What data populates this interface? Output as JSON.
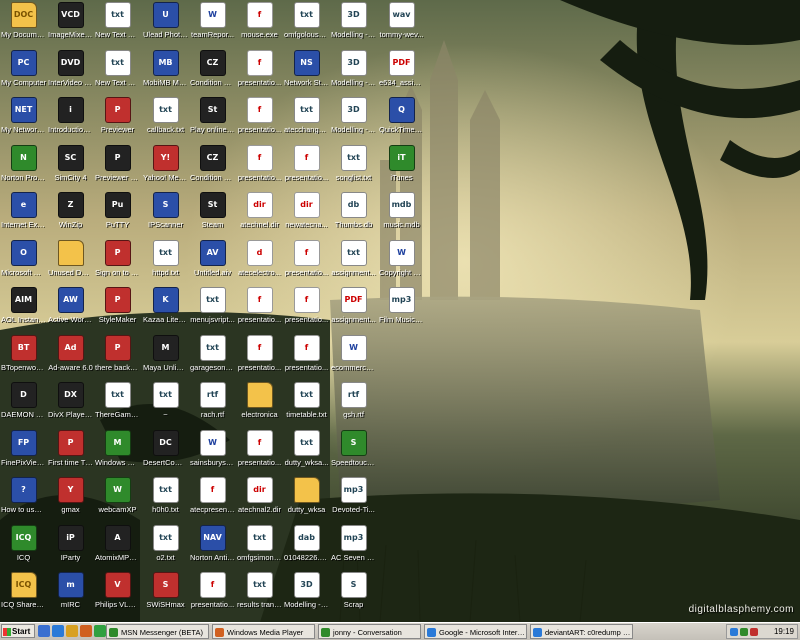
{
  "desktop": {
    "watermark": "digitalblasphemy.com",
    "icons": [
      {
        "label": "My Documents",
        "type": "folder",
        "glyph": "DOC"
      },
      {
        "label": "My Computer",
        "type": "app",
        "glyph": "PC"
      },
      {
        "label": "My Network Places",
        "type": "app",
        "glyph": "NET"
      },
      {
        "label": "Norton Protecte...",
        "type": "green",
        "glyph": "N"
      },
      {
        "label": "Internet Explorer",
        "type": "app",
        "glyph": "e"
      },
      {
        "label": "Microsoft Outlook",
        "type": "app",
        "glyph": "O"
      },
      {
        "label": "AOL Instant Messenger",
        "type": "dark",
        "glyph": "AIM"
      },
      {
        "label": "BTopenworld Broadband",
        "type": "red",
        "glyph": "BT"
      },
      {
        "label": "DAEMON Tools",
        "type": "dark",
        "glyph": "D"
      },
      {
        "label": "FinePixViewer",
        "type": "app",
        "glyph": "FP"
      },
      {
        "label": "How to use FinePixViewer",
        "type": "app",
        "glyph": "?"
      },
      {
        "label": "ICQ",
        "type": "green",
        "glyph": "ICQ"
      },
      {
        "label": "ICQ Shared Files",
        "type": "folder",
        "glyph": "ICQ"
      },
      {
        "label": "ImageMixer VCD for ...",
        "type": "dark",
        "glyph": "VCD"
      },
      {
        "label": "InterVideo WinDVD",
        "type": "dark",
        "glyph": "DVD"
      },
      {
        "label": "Introduction of Picture T...",
        "type": "dark",
        "glyph": "i"
      },
      {
        "label": "SimCity 4",
        "type": "dark",
        "glyph": "SC"
      },
      {
        "label": "WinZip",
        "type": "dark",
        "glyph": "Z"
      },
      {
        "label": "Unused Deskto...",
        "type": "folder",
        "glyph": ""
      },
      {
        "label": "Active Worlds",
        "type": "app",
        "glyph": "AW"
      },
      {
        "label": "Ad-aware 6.0",
        "type": "red",
        "glyph": "Ad"
      },
      {
        "label": "DivX Player 2.0 Alpha",
        "type": "dark",
        "glyph": "DX"
      },
      {
        "label": "First time There",
        "type": "red",
        "glyph": "P"
      },
      {
        "label": "gmax",
        "type": "red",
        "glyph": "Y"
      },
      {
        "label": "IParty",
        "type": "dark",
        "glyph": "iP"
      },
      {
        "label": "mIRC",
        "type": "app",
        "glyph": "m"
      },
      {
        "label": "New Text Docum...",
        "type": "doc",
        "glyph": "txt"
      },
      {
        "label": "New Text Document.txt",
        "type": "doc",
        "glyph": "txt"
      },
      {
        "label": "Previewer",
        "type": "red",
        "glyph": "P"
      },
      {
        "label": "Previewer Documenta...",
        "type": "dark",
        "glyph": "P"
      },
      {
        "label": "PuTTY",
        "type": "dark",
        "glyph": "Pu"
      },
      {
        "label": "Sign on to There",
        "type": "red",
        "glyph": "P"
      },
      {
        "label": "StyleMaker",
        "type": "red",
        "glyph": "P"
      },
      {
        "label": "there backdoor",
        "type": "red",
        "glyph": "P"
      },
      {
        "label": "ThereGame....",
        "type": "doc",
        "glyph": "txt"
      },
      {
        "label": "Windows Messenger",
        "type": "green",
        "glyph": "M"
      },
      {
        "label": "webcamXP",
        "type": "green",
        "glyph": "W"
      },
      {
        "label": "AtomixMP3 Trial",
        "type": "dark",
        "glyph": "A"
      },
      {
        "label": "Philips VLounge",
        "type": "red",
        "glyph": "V"
      },
      {
        "label": "Ulead Photo Explorer 6.0",
        "type": "app",
        "glyph": "U"
      },
      {
        "label": "MobiMB Mobile Media Browser",
        "type": "app",
        "glyph": "MB"
      },
      {
        "label": "callback.txt",
        "type": "doc",
        "glyph": "txt"
      },
      {
        "label": "Yahoo! Messenger",
        "type": "red",
        "glyph": "Y!"
      },
      {
        "label": "IPScanner",
        "type": "app",
        "glyph": "S"
      },
      {
        "label": "httpd.txt",
        "type": "doc",
        "glyph": "txt"
      },
      {
        "label": "Kazaa Lite K++",
        "type": "app",
        "glyph": "K"
      },
      {
        "label": "Maya Unlimited 5.0",
        "type": "dark",
        "glyph": "M"
      },
      {
        "label": "~",
        "type": "doc",
        "glyph": "txt"
      },
      {
        "label": "DesertCombat...",
        "type": "dark",
        "glyph": "DC"
      },
      {
        "label": "h0h0.txt",
        "type": "doc",
        "glyph": "txt"
      },
      {
        "label": "o2.txt",
        "type": "doc",
        "glyph": "txt"
      },
      {
        "label": "SWiSHmax",
        "type": "red",
        "glyph": "S"
      },
      {
        "label": "teamRepor...",
        "type": "word",
        "glyph": "W"
      },
      {
        "label": "Condition Zero",
        "type": "dark",
        "glyph": "CZ"
      },
      {
        "label": "Play online using Steam",
        "type": "dark",
        "glyph": "St"
      },
      {
        "label": "Condition Zero Deleted Sce...",
        "type": "dark",
        "glyph": "CZ"
      },
      {
        "label": "Steam",
        "type": "dark",
        "glyph": "St"
      },
      {
        "label": "Untitled.aiv",
        "type": "app",
        "glyph": "AV"
      },
      {
        "label": "menujsvript...",
        "type": "doc",
        "glyph": "txt"
      },
      {
        "label": "garagesong...",
        "type": "doc",
        "glyph": "txt"
      },
      {
        "label": "rach.rtf",
        "type": "doc",
        "glyph": "rtf"
      },
      {
        "label": "sainsburystr...",
        "type": "word",
        "glyph": "W"
      },
      {
        "label": "atecpresent...",
        "type": "flash",
        "glyph": "f"
      },
      {
        "label": "Norton AntiVirus 20...",
        "type": "app",
        "glyph": "NAV"
      },
      {
        "label": "presentatio...",
        "type": "flash",
        "glyph": "f"
      },
      {
        "label": "mouse.exe",
        "type": "flash",
        "glyph": "f"
      },
      {
        "label": "presentatio...",
        "type": "flash",
        "glyph": "f"
      },
      {
        "label": "presentatio...",
        "type": "flash",
        "glyph": "f"
      },
      {
        "label": "presentatio...",
        "type": "flash",
        "glyph": "f"
      },
      {
        "label": "atechnel.dir",
        "type": "flash",
        "glyph": "dir"
      },
      {
        "label": "atecelectro...",
        "type": "flash",
        "glyph": "d"
      },
      {
        "label": "presentatio...",
        "type": "flash",
        "glyph": "f"
      },
      {
        "label": "presentatio...",
        "type": "flash",
        "glyph": "f"
      },
      {
        "label": "electronica",
        "type": "folder",
        "glyph": ""
      },
      {
        "label": "presentatio...",
        "type": "flash",
        "glyph": "f"
      },
      {
        "label": "atechnal2.dir",
        "type": "flash",
        "glyph": "dir"
      },
      {
        "label": "omfgsimon.txt",
        "type": "doc",
        "glyph": "txt"
      },
      {
        "label": "results transcript si...",
        "type": "doc",
        "glyph": "txt"
      },
      {
        "label": "omfgolouse.txt",
        "type": "doc",
        "glyph": "txt"
      },
      {
        "label": "Network Stumbler",
        "type": "app",
        "glyph": "NS"
      },
      {
        "label": "atecchange...",
        "type": "doc",
        "glyph": "txt"
      },
      {
        "label": "presentatio...",
        "type": "flash",
        "glyph": "f"
      },
      {
        "label": "newatecna...",
        "type": "flash",
        "glyph": "dir"
      },
      {
        "label": "presentatio...",
        "type": "flash",
        "glyph": "f"
      },
      {
        "label": "presentatio...",
        "type": "flash",
        "glyph": "f"
      },
      {
        "label": "presentatio...",
        "type": "flash",
        "glyph": "f"
      },
      {
        "label": "timetable.txt",
        "type": "doc",
        "glyph": "txt"
      },
      {
        "label": "dutty_wksa...",
        "type": "doc",
        "glyph": "txt"
      },
      {
        "label": "dutty_wksa",
        "type": "folder",
        "glyph": ""
      },
      {
        "label": "01048226.dab",
        "type": "doc",
        "glyph": "dab"
      },
      {
        "label": "Modelling - June 20...",
        "type": "doc",
        "glyph": "3D"
      },
      {
        "label": "Modelling - June 20...",
        "type": "doc",
        "glyph": "3D"
      },
      {
        "label": "Modelling - June 20...",
        "type": "doc",
        "glyph": "3D"
      },
      {
        "label": "Modelling - June 20...",
        "type": "doc",
        "glyph": "3D"
      },
      {
        "label": "songlist.txt",
        "type": "doc",
        "glyph": "txt"
      },
      {
        "label": "Thumbs.db",
        "type": "doc",
        "glyph": "db"
      },
      {
        "label": "assignment...",
        "type": "doc",
        "glyph": "txt"
      },
      {
        "label": "assignment...",
        "type": "pdf",
        "glyph": "PDF"
      },
      {
        "label": "ecommercerep ort.doc",
        "type": "word",
        "glyph": "W"
      },
      {
        "label": "gsh.rtf",
        "type": "doc",
        "glyph": "rtf"
      },
      {
        "label": "Speedtouch Connection",
        "type": "green",
        "glyph": "S"
      },
      {
        "label": "Devoted-Ti...",
        "type": "doc",
        "glyph": "mp3"
      },
      {
        "label": "AC Seven - House E...",
        "type": "doc",
        "glyph": "mp3"
      },
      {
        "label": "Scrap",
        "type": "doc",
        "glyph": "S"
      },
      {
        "label": "tommy-wev...",
        "type": "doc",
        "glyph": "wav"
      },
      {
        "label": "e634_assig... 04.pdf",
        "type": "pdf",
        "glyph": "PDF"
      },
      {
        "label": "QuickTime Player",
        "type": "app",
        "glyph": "Q"
      },
      {
        "label": "iTunes",
        "type": "green",
        "glyph": "iT"
      },
      {
        "label": "music.mdb",
        "type": "doc",
        "glyph": "mdb"
      },
      {
        "label": "Copyright permissi...",
        "type": "word",
        "glyph": "W"
      },
      {
        "label": "Film Music 2.mp3",
        "type": "doc",
        "glyph": "mp3"
      }
    ]
  },
  "taskbar": {
    "start_label": "Start",
    "quick_launch": [
      {
        "name": "show-desktop-icon",
        "color": "#3a6fd0"
      },
      {
        "name": "internet-explorer-icon",
        "color": "#2a7ad8"
      },
      {
        "name": "outlook-icon",
        "color": "#d8a020"
      },
      {
        "name": "media-player-icon",
        "color": "#d06020"
      },
      {
        "name": "messenger-icon",
        "color": "#30a040"
      }
    ],
    "buttons": [
      {
        "label": "MSN Messenger (BETA)",
        "color": "#2f8a2b"
      },
      {
        "label": "Windows Media Player",
        "color": "#d06020"
      },
      {
        "label": "jonny - Conversation",
        "color": "#2f8a2b"
      },
      {
        "label": "Google - Microsoft Intern...",
        "color": "#2a7ad8"
      },
      {
        "label": "deviantART: c0redump - ...",
        "color": "#2a7ad8"
      }
    ],
    "clock": "19:19"
  }
}
